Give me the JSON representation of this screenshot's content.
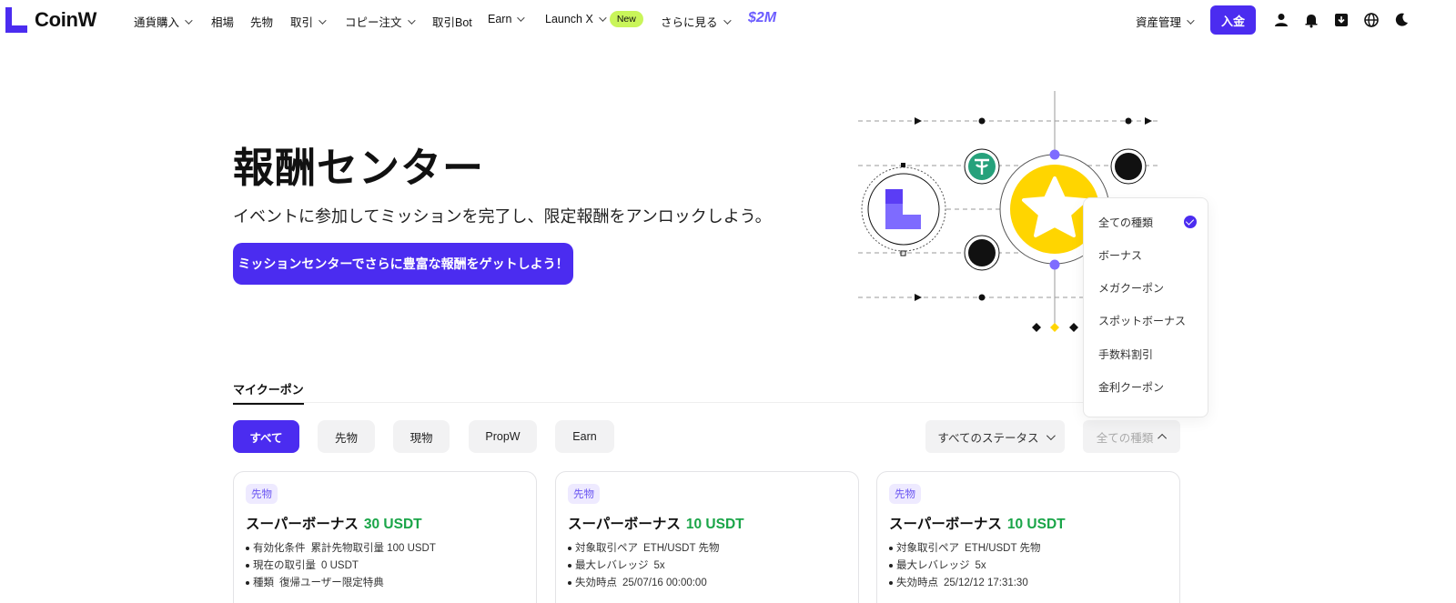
{
  "brand": {
    "name": "CoinW",
    "accent": "#4b2cf0"
  },
  "nav": {
    "items": [
      {
        "label": "通貨購入",
        "dropdown": true
      },
      {
        "label": "相場",
        "dropdown": false
      },
      {
        "label": "先物",
        "dropdown": false
      },
      {
        "label": "取引",
        "dropdown": true
      },
      {
        "label": "コピー注文",
        "dropdown": true
      },
      {
        "label": "取引Bot",
        "dropdown": false
      },
      {
        "label": "Earn",
        "dropdown": true
      },
      {
        "label": "Launch X",
        "dropdown": true,
        "badge": "New"
      },
      {
        "label": "さらに見る",
        "dropdown": true
      }
    ],
    "promo": "$2M",
    "assets_label": "資産管理",
    "deposit_label": "入金",
    "icons": [
      "user-icon",
      "bell-icon",
      "download-icon",
      "globe-icon",
      "moon-icon"
    ]
  },
  "hero": {
    "title": "報酬センター",
    "subtitle": "イベントに参加してミッションを完了し、限定報酬をアンロックしよう。",
    "cta": "ミッションセンターでさらに豊富な報酬をゲットしよう！"
  },
  "tabs": {
    "active": "マイクーポン"
  },
  "filters": [
    {
      "label": "すべて",
      "active": true
    },
    {
      "label": "先物",
      "active": false
    },
    {
      "label": "現物",
      "active": false
    },
    {
      "label": "PropW",
      "active": false
    },
    {
      "label": "Earn",
      "active": false
    }
  ],
  "status_select": {
    "value": "すべてのステータス"
  },
  "type_select": {
    "value": "全ての種類",
    "open": true,
    "options": [
      "全ての種類",
      "ボーナス",
      "メガクーポン",
      "スポットボーナス",
      "手数料割引",
      "金利クーポン"
    ],
    "selected": "全ての種類"
  },
  "cards": [
    {
      "tag": "先物",
      "title": "スーパーボーナス",
      "amount": "30 USDT",
      "lines": [
        {
          "label": "有効化条件",
          "value": "累計先物取引量 100 USDT"
        },
        {
          "label": "現在の取引量",
          "value": "0 USDT"
        },
        {
          "label": "種類",
          "value": "復帰ユーザー限定特典"
        }
      ]
    },
    {
      "tag": "先物",
      "title": "スーパーボーナス",
      "amount": "10 USDT",
      "lines": [
        {
          "label": "対象取引ペア",
          "value": "ETH/USDT 先物"
        },
        {
          "label": "最大レバレッジ",
          "value": "5x"
        },
        {
          "label": "失効時点",
          "value": "25/07/16 00:00:00"
        }
      ]
    },
    {
      "tag": "先物",
      "title": "スーパーボーナス",
      "amount": "10 USDT",
      "lines": [
        {
          "label": "対象取引ペア",
          "value": "ETH/USDT 先物"
        },
        {
          "label": "最大レバレッジ",
          "value": "5x"
        },
        {
          "label": "失効時点",
          "value": "25/12/12 17:31:30"
        }
      ]
    }
  ]
}
